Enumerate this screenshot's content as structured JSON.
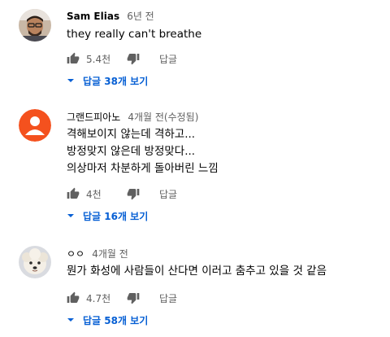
{
  "comments": [
    {
      "author": "Sam Elias",
      "time": "6년 전",
      "lines": [
        "they really can't breathe"
      ],
      "likes": "5.4천",
      "reply_label": "답글",
      "replies_label": "답글 38개 보기"
    },
    {
      "author": "그랜드피아노",
      "time": "4개월 전(수정됨)",
      "lines": [
        "격해보이지 않는데 격하고...",
        "방정맞지 않은데 방정맞다...",
        "의상마저 차분하게 돌아버린 느낌"
      ],
      "likes": "4천",
      "reply_label": "답글",
      "replies_label": "답글 16개 보기"
    },
    {
      "author": "ㅇㅇ",
      "time": "4개월 전",
      "lines": [
        "뭔가 화성에 사람들이 산다면 이러고 춤추고 있을 것 같음"
      ],
      "likes": "4.7천",
      "reply_label": "답글",
      "replies_label": "답글 58개 보기"
    }
  ],
  "colors": {
    "link": "#065fd4",
    "secondary_text": "#606060",
    "orange_avatar": "#f4511e"
  },
  "icons": {
    "like": "thumbs-up-icon",
    "dislike": "thumbs-down-icon",
    "expand": "caret-down-icon"
  }
}
